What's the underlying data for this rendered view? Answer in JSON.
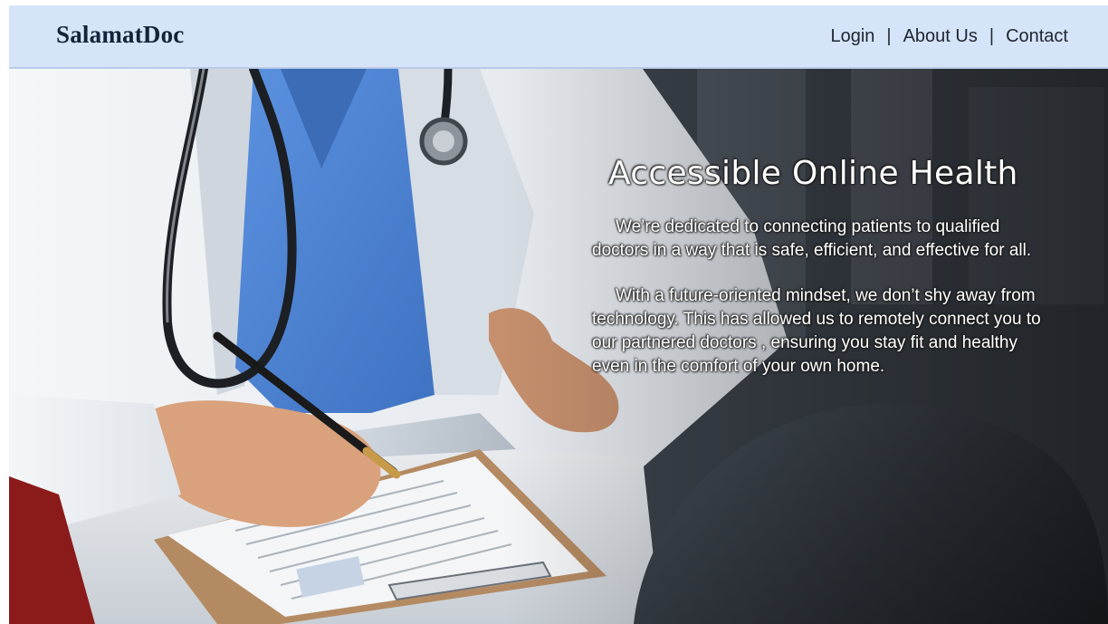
{
  "header": {
    "brand": "SalamatDoc",
    "nav": {
      "login": "Login",
      "about": "About Us",
      "contact": "Contact",
      "separator": "|"
    }
  },
  "hero": {
    "title": "Accessible Online Health",
    "paragraph_1": "We’re dedicated to connecting patients to qualified doctors in a way that is safe, efficient, and effective for all.",
    "paragraph_2": "With a future-oriented mindset, we don’t shy away from technology. This has allowed us to remotely connect you to our partnered doctors , ensuring you stay fit and healthy even in the comfort of your own home.",
    "background_image": "doctor-writing-on-clipboard-with-patient-photo"
  },
  "colors": {
    "header_background": "#d5e4f8",
    "brand_text": "#15223a",
    "nav_text": "#1e2530",
    "hero_text": "#ffffff",
    "scrubs": "#4f86d6"
  }
}
